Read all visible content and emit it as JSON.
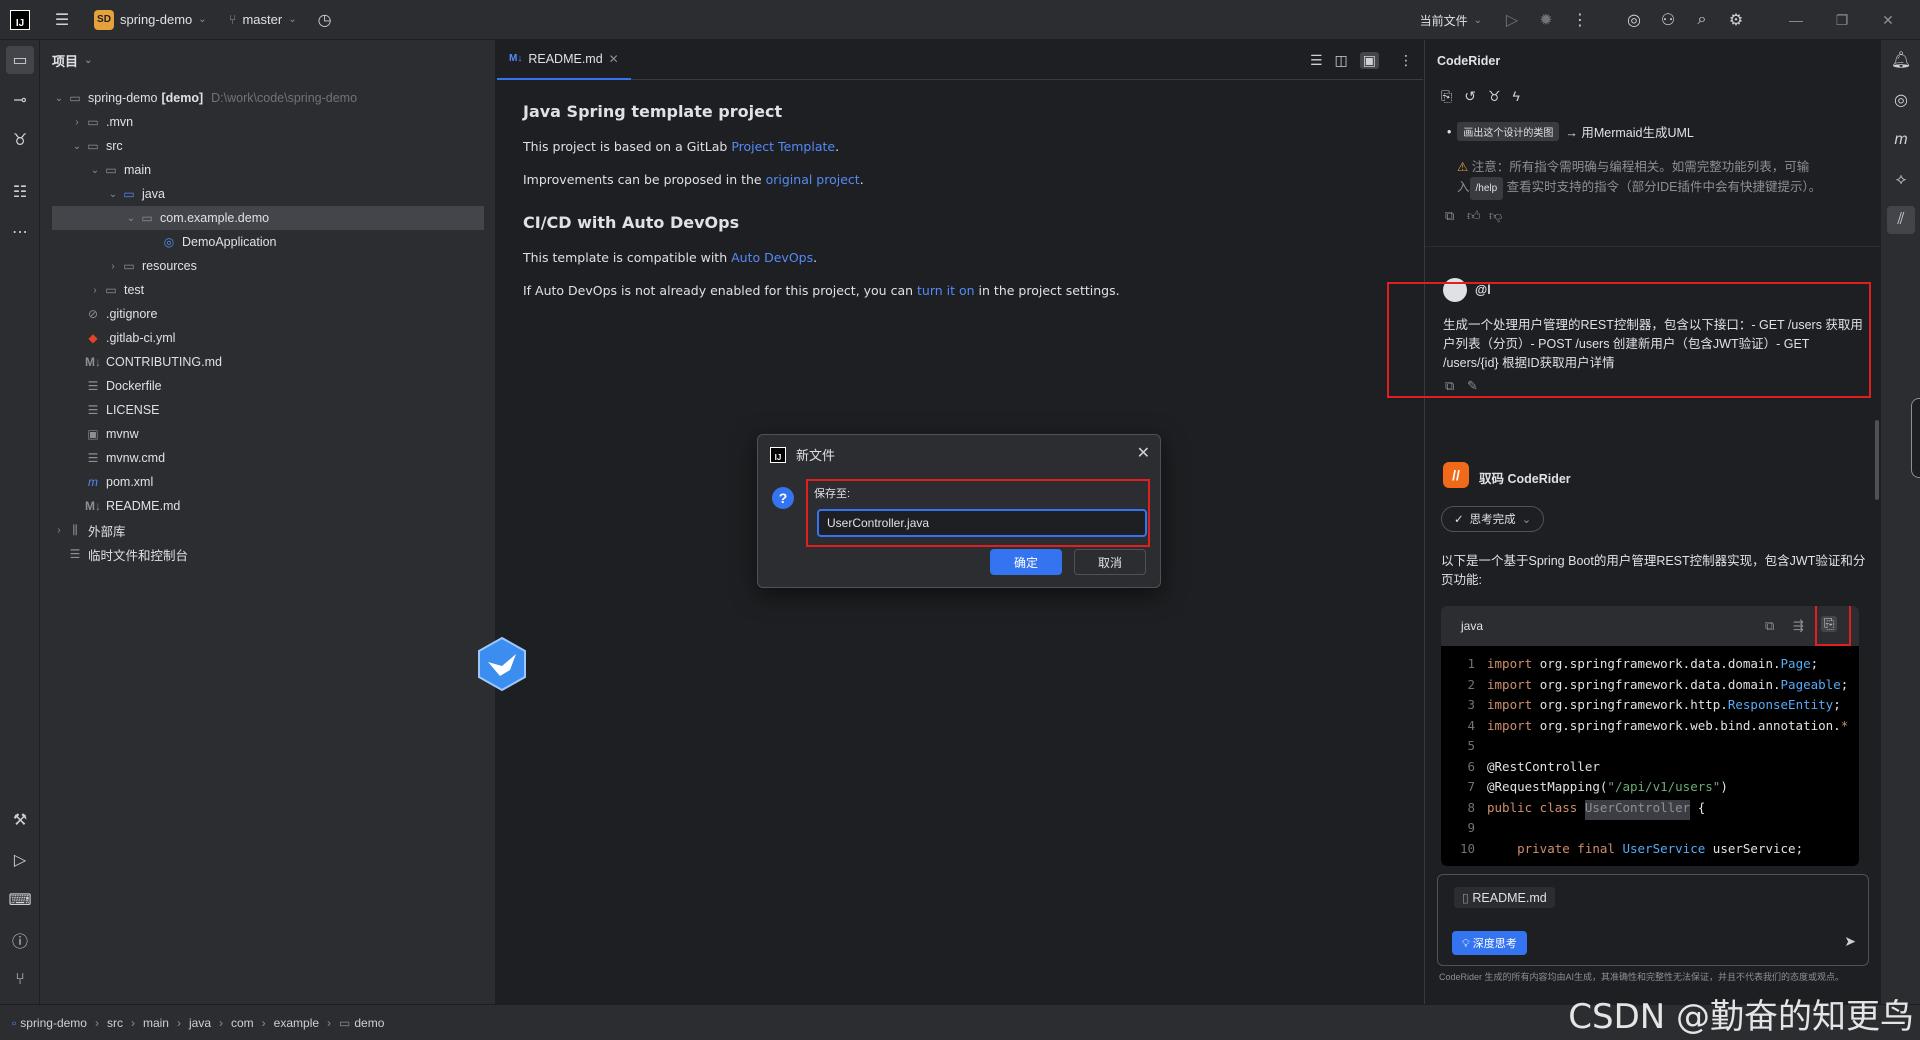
{
  "titlebar": {
    "logo": "IJ",
    "project_badge": "SD",
    "project_name": "spring-demo",
    "branch": "master",
    "run_config": "当前文件"
  },
  "project_panel": {
    "title": "项目",
    "tree": [
      {
        "label": "spring-demo",
        "bold_suffix": "[demo]",
        "path": "D:\\work\\code\\spring-demo"
      },
      {
        "label": ".mvn"
      },
      {
        "label": "src"
      },
      {
        "label": "main"
      },
      {
        "label": "java"
      },
      {
        "label": "com.example.demo"
      },
      {
        "label": "DemoApplication"
      },
      {
        "label": "resources"
      },
      {
        "label": "test"
      },
      {
        "label": ".gitignore"
      },
      {
        "label": ".gitlab-ci.yml"
      },
      {
        "label": "CONTRIBUTING.md"
      },
      {
        "label": "Dockerfile"
      },
      {
        "label": "LICENSE"
      },
      {
        "label": "mvnw"
      },
      {
        "label": "mvnw.cmd"
      },
      {
        "label": "pom.xml"
      },
      {
        "label": "README.md"
      },
      {
        "label": "外部库"
      },
      {
        "label": "临时文件和控制台"
      }
    ]
  },
  "editor": {
    "tab_label": "README.md",
    "h1": "Java Spring template project",
    "p1_pre": "This project is based on a GitLab ",
    "p1_link": "Project Template",
    "p1_post": ".",
    "p2_pre": "Improvements can be proposed in the ",
    "p2_link": "original project",
    "p2_post": ".",
    "h2": "CI/CD with Auto DevOps",
    "p3_pre": "This template is compatible with ",
    "p3_link": "Auto DevOps",
    "p3_post": ".",
    "p4_pre": "If Auto DevOps is not already enabled for this project, you can ",
    "p4_link": "turn it on",
    "p4_post": " in the project settings."
  },
  "dialog": {
    "title": "新文件",
    "label": "保存至:",
    "value": "UserController.java",
    "ok": "确定",
    "cancel": "取消"
  },
  "coderider": {
    "title": "CodeRider",
    "chip1": "画出这个设计的类图",
    "chip1_arrow": "→ 用Mermaid生成UML",
    "warning_1": "注意：所有指令需明确与编程相关。如需完整功能列表，可输",
    "warning_2_pre": "入",
    "warning_help": "/help",
    "warning_2_post": " 查看实时支持的指令（部分IDE插件中会有快捷键提示）。",
    "user_name": "@l",
    "user_message": "生成一个处理用户管理的REST控制器，包含以下接口：- GET /users 获取用户列表（分页）- POST /users 创建新用户（包含JWT验证）- GET /users/{id} 根据ID获取用户详情",
    "bot_name": "驭码 CodeRider",
    "think_label": "思考完成",
    "reply_intro": "以下是一个基于Spring Boot的用户管理REST控制器实现，包含JWT验证和分页功能:",
    "code_lang": "java",
    "code_lines": [
      {
        "n": "1",
        "kind": "import",
        "pkg": "org.springframework.data.domain.",
        "cls": "Page",
        "end": ";"
      },
      {
        "n": "2",
        "kind": "import",
        "pkg": "org.springframework.data.domain.",
        "cls": "Pageable",
        "end": ";"
      },
      {
        "n": "3",
        "kind": "import",
        "pkg": "org.springframework.http.",
        "cls": "ResponseEntity",
        "end": ";"
      },
      {
        "n": "4",
        "kind": "import",
        "pkg": "org.springframework.web.bind.annotation.",
        "cls": "*",
        "end": ""
      },
      {
        "n": "5"
      },
      {
        "n": "6",
        "text": "@RestController"
      },
      {
        "n": "7",
        "text": "@RequestMapping(",
        "str": "\"/api/v1/users\"",
        "end": ")"
      },
      {
        "n": "8",
        "kw": "public class ",
        "hl": "UserController",
        "end": " {"
      },
      {
        "n": "9"
      },
      {
        "n": "10",
        "kw": "    private final ",
        "cls": "UserService",
        "end": " userService;"
      }
    ],
    "attached_file": "README.md",
    "deep_think": "深度思考",
    "footer": "CodeRider 生成的所有内容均由AI生成，其准确性和完整性无法保证，并且不代表我们的态度或观点。"
  },
  "statusbar": {
    "crumbs": [
      "spring-demo",
      "src",
      "main",
      "java",
      "com",
      "example",
      "demo"
    ],
    "watermark": "CSDN @勤奋的知更鸟"
  }
}
